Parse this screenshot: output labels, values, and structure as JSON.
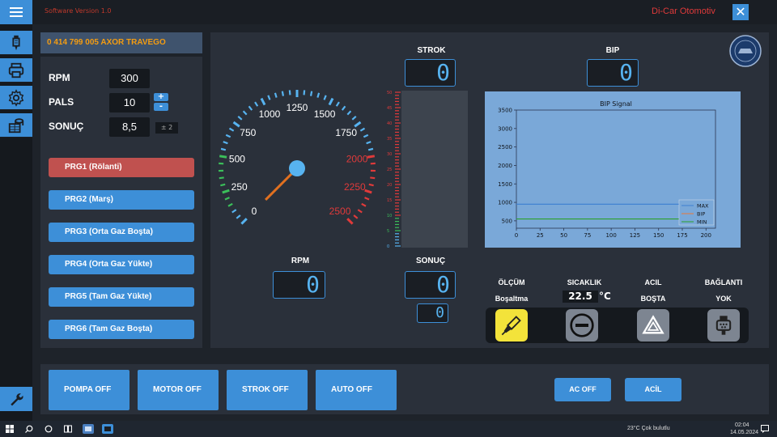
{
  "titlebar": {
    "version": "Software Version 1.0",
    "brand": "Di-Car Otomotiv",
    "close": "✕"
  },
  "vehicle": "0 414 799 005 AXOR TRAVEGO",
  "params": {
    "rpm_label": "RPM",
    "rpm_value": "300",
    "pals_label": "PALS",
    "pals_value": "10",
    "sonuc_label": "SONUÇ",
    "sonuc_value": "8,5",
    "plus": "+",
    "minus": "-",
    "tolerance": "± 2"
  },
  "programs": [
    "PRG1 (Rölanti)",
    "PRG2 (Marş)",
    "PRG3 (Orta Gaz Boşta)",
    "PRG4 (Orta Gaz Yükte)",
    "PRG5 (Tam Gaz Yükte)",
    "PRG6 (Tam Gaz Boşta)"
  ],
  "displays": {
    "strok_label": "STROK",
    "strok_value": "0",
    "bip_label": "BIP",
    "bip_value": "0",
    "rpm_label": "RPM",
    "rpm_value": "0",
    "sonuc_label": "SONUÇ",
    "sonuc_value": "0",
    "small_value": "0"
  },
  "gauge": {
    "labels": [
      "0",
      "250",
      "500",
      "750",
      "1000",
      "1250",
      "1500",
      "1750",
      "2000",
      "2250",
      "2500"
    ],
    "value": 0,
    "max": 2500
  },
  "bar_scale": [
    "50",
    "45",
    "40",
    "35",
    "30",
    "25",
    "20",
    "15",
    "10",
    "5",
    "0"
  ],
  "chart_data": {
    "type": "line",
    "title": "BIP Signal",
    "x_ticks": [
      "0",
      "25",
      "50",
      "75",
      "100",
      "125",
      "150",
      "175",
      "200"
    ],
    "y_ticks": [
      "500",
      "1000",
      "1500",
      "2000",
      "2500",
      "3000",
      "3500"
    ],
    "xlim": [
      0,
      210
    ],
    "ylim": [
      300,
      3500
    ],
    "series": [
      {
        "name": "MAX",
        "color": "#3d7fd0",
        "x": [
          0,
          175
        ],
        "y": [
          950,
          950
        ]
      },
      {
        "name": "BIP",
        "color": "#e8793a",
        "x": [],
        "y": []
      },
      {
        "name": "MIN",
        "color": "#2ca02c",
        "x": [
          0,
          175
        ],
        "y": [
          550,
          550
        ]
      }
    ],
    "legend": "bottom-right"
  },
  "status": {
    "olcum": "ÖLÇÜM",
    "olcum_sub": "Boşaltma",
    "sicaklik": "SICAKLIK",
    "temp": "22.5",
    "unit": "°C",
    "acil": "ACIL",
    "acil_sub": "BOŞTA",
    "baglanti": "BAĞLANTI",
    "baglanti_sub": "YOK"
  },
  "bottom": {
    "pompa": "POMPA OFF",
    "motor": "MOTOR OFF",
    "strok": "STROK OFF",
    "auto": "AUTO OFF",
    "ac": "AC OFF",
    "acil": "ACİL"
  },
  "taskbar": {
    "weather": "23°C  Çok bulutlu",
    "time": "02:04",
    "date": "14.05.2024"
  }
}
